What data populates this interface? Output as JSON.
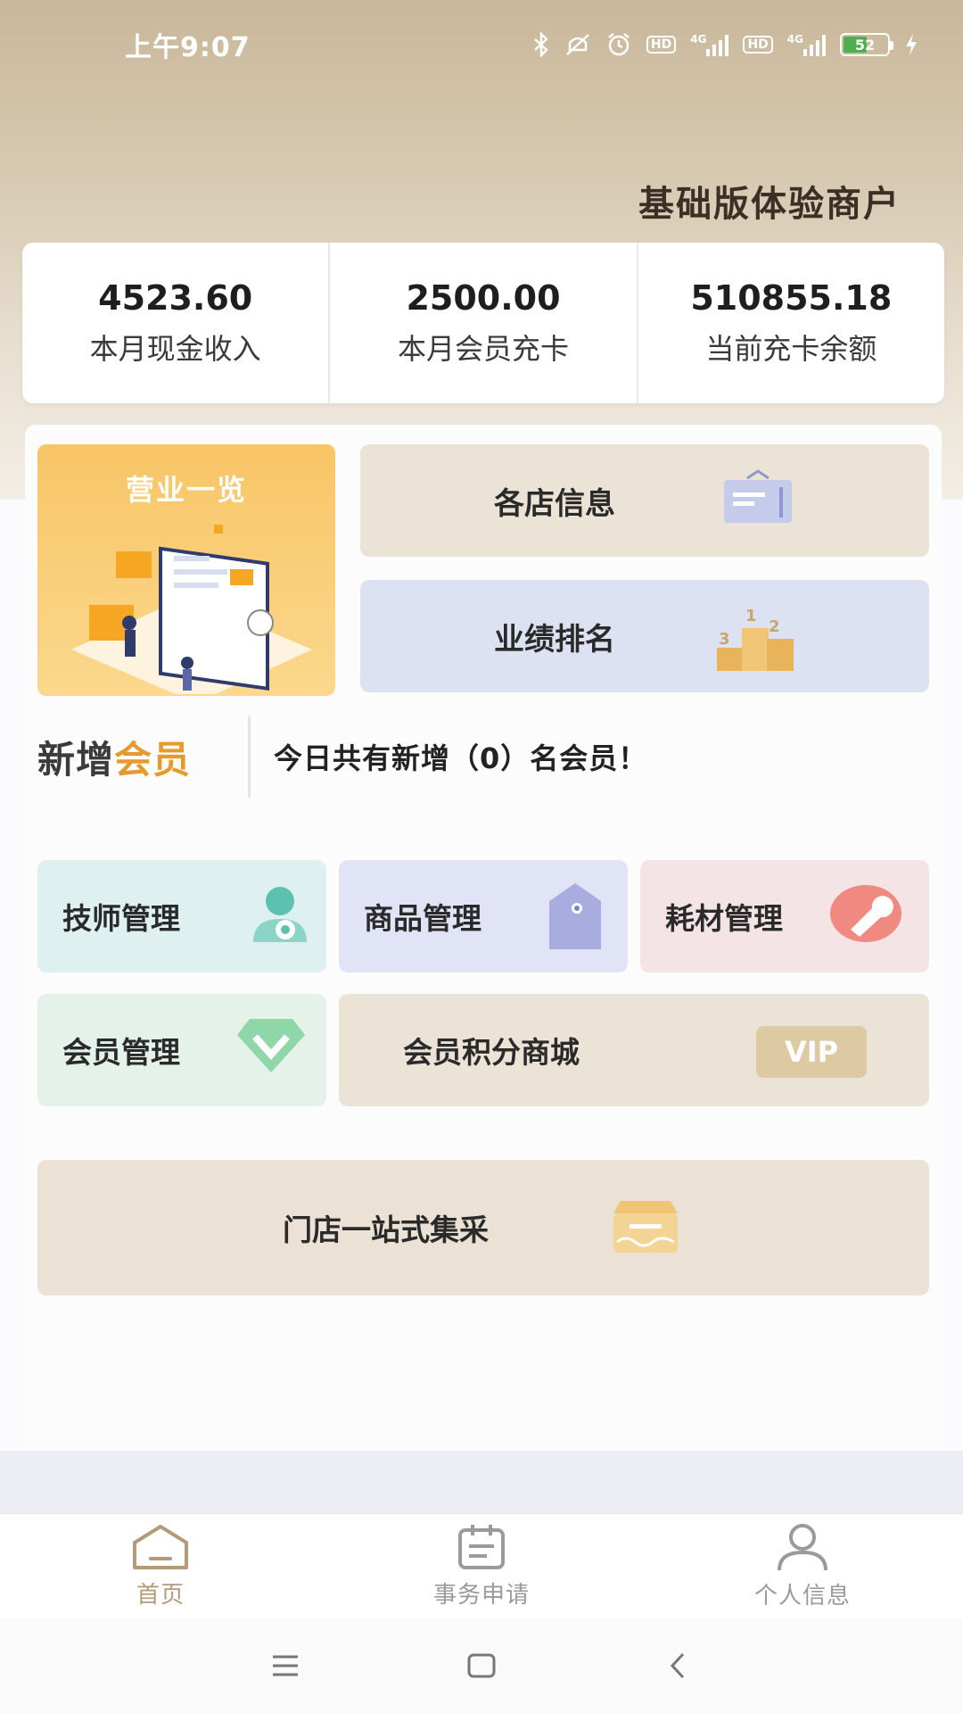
{
  "status_bar": {
    "time": "上午9:07",
    "hd1": "HD",
    "net1": "4G",
    "hd2": "HD",
    "net2": "4G",
    "battery": "52"
  },
  "merchant": {
    "title": "基础版体验商户"
  },
  "stats": [
    {
      "value": "4523.60",
      "label": "本月现金收入"
    },
    {
      "value": "2500.00",
      "label": "本月会员充卡"
    },
    {
      "value": "510855.18",
      "label": "当前充卡余额"
    }
  ],
  "business_overview": {
    "title": "营业一览"
  },
  "quick_cards": {
    "store_info": "各店信息",
    "ranking": "业绩排名"
  },
  "new_member": {
    "logo_part1": "新增",
    "logo_part2": "会员",
    "message": "今日共有新增（0）名会员！"
  },
  "tiles": {
    "tech": "技师管理",
    "goods": "商品管理",
    "material": "耗材管理",
    "member": "会员管理",
    "points_mall": "会员积分商城",
    "vip_badge": "VIP",
    "purchase": "门店一站式集采"
  },
  "bottom_nav": [
    {
      "label": "首页",
      "icon": "home-icon",
      "active": true
    },
    {
      "label": "事务申请",
      "icon": "calendar-icon",
      "active": false
    },
    {
      "label": "个人信息",
      "icon": "user-icon",
      "active": false
    }
  ],
  "colors": {
    "accent": "#b59a78",
    "orange": "#e59a2b",
    "card_beige": "#ece3d7",
    "card_blue": "#dde2f3"
  }
}
